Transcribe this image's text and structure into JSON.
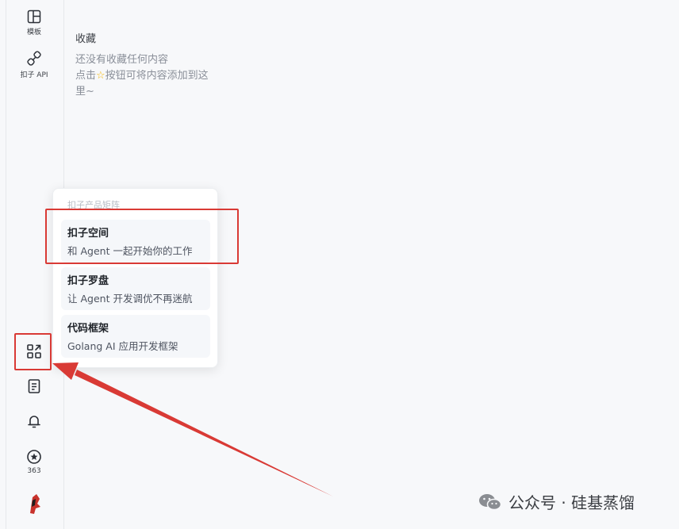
{
  "rail": {
    "items": [
      {
        "label": "模板",
        "icon": "template-icon"
      },
      {
        "label": "扣子 API",
        "icon": "api-icon"
      }
    ],
    "bottom": {
      "apps_icon": "apps-icon",
      "docs_icon": "document-icon",
      "bell_icon": "bell-icon",
      "points_icon": "coin-icon",
      "points_count": "363"
    }
  },
  "favorites": {
    "title": "收藏",
    "hint_line1": "还没有收藏任何内容",
    "hint_before_star": "点击",
    "hint_after_star": "按钮可将内容添加到这里~"
  },
  "product_menu": {
    "header": "扣子产品矩阵",
    "items": [
      {
        "title": "扣子空间",
        "desc": "和 Agent 一起开始你的工作"
      },
      {
        "title": "扣子罗盘",
        "desc": "让 Agent 开发调优不再迷航"
      },
      {
        "title": "代码框架",
        "desc": "Golang AI 应用开发框架"
      }
    ]
  },
  "colors": {
    "highlight": "#d93a35",
    "accent_star": "#f5b70a"
  },
  "watermark": {
    "text": "公众号 · 硅基蒸馏"
  }
}
